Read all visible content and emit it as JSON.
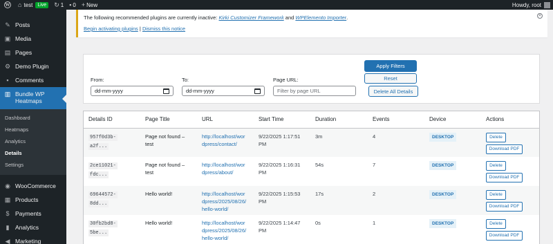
{
  "adminbar": {
    "site_name": "test",
    "live_badge": "Live",
    "updates_count": "1",
    "comments_count": "0",
    "new_label": "New",
    "howdy": "Howdy, root"
  },
  "sidebar": {
    "items": [
      {
        "label": "Posts",
        "icon": "pushpin-icon"
      },
      {
        "label": "Media",
        "icon": "media-icon"
      },
      {
        "label": "Pages",
        "icon": "pages-icon"
      },
      {
        "label": "Demo Plugin",
        "icon": "gear-icon"
      },
      {
        "label": "Comments",
        "icon": "comment-icon"
      }
    ],
    "current": {
      "label_line1": "Bundle WP",
      "label_line2": "Heatmaps",
      "icon": "chart-icon"
    },
    "submenu": [
      "Dashboard",
      "Heatmaps",
      "Analytics",
      "Details",
      "Settings"
    ],
    "active_submenu": "Details",
    "items_after": [
      {
        "label": "WooCommerce",
        "icon": "woo-icon"
      },
      {
        "label": "Products",
        "icon": "products-icon"
      },
      {
        "label": "Payments",
        "icon": "payments-icon"
      },
      {
        "label": "Analytics",
        "icon": "analytics-icon"
      },
      {
        "label": "Marketing",
        "icon": "megaphone-icon"
      }
    ]
  },
  "notice": {
    "text_before": "The following recommended plugins are currently inactive: ",
    "plugin1": "Kirki Customizer Framework",
    "and_text": " and ",
    "plugin2": "WPElemento Importer",
    "period": ".",
    "begin_link": "Begin activating plugins",
    "divider": " | ",
    "dismiss_link": "Dismiss this notice"
  },
  "filters": {
    "from_label": "From:",
    "from_value": "dd-mm-yyyy",
    "to_label": "To:",
    "to_value": "dd-mm-yyyy",
    "url_label": "Page URL:",
    "url_placeholder": "Filter by page URL",
    "apply_label": "Apply Filters",
    "reset_label": "Reset",
    "delete_all_label": "Delete All Details"
  },
  "table": {
    "headers": [
      "Details ID",
      "Page Title",
      "URL",
      "Start Time",
      "Duration",
      "Events",
      "Device",
      "Actions"
    ],
    "delete_label": "Delete",
    "pdf_label": "Download PDF",
    "rows": [
      {
        "id_line1": "957f0d3b-",
        "id_line2": "a2f...",
        "title_line1": "Page not found –",
        "title_line2": "test",
        "url_line1": "http://localhost/wor",
        "url_line2": "dpress/contact/",
        "url_line3": "",
        "time_line1": "9/22/2025 1:17:51",
        "time_line2": "PM",
        "duration": "3m",
        "events": "4",
        "device": "DESKTOP"
      },
      {
        "id_line1": "2ce11021-",
        "id_line2": "fdc...",
        "title_line1": "Page not found –",
        "title_line2": "test",
        "url_line1": "http://localhost/wor",
        "url_line2": "dpress/about/",
        "url_line3": "",
        "time_line1": "9/22/2025 1:16:31",
        "time_line2": "PM",
        "duration": "54s",
        "events": "7",
        "device": "DESKTOP"
      },
      {
        "id_line1": "69644572-",
        "id_line2": "8dd...",
        "title_line1": "Hello world!",
        "title_line2": "",
        "url_line1": "http://localhost/wor",
        "url_line2": "dpress/2025/08/26/",
        "url_line3": "hello-world/",
        "time_line1": "9/22/2025 1:15:53",
        "time_line2": "PM",
        "duration": "17s",
        "events": "2",
        "device": "DESKTOP"
      },
      {
        "id_line1": "30fb2bd8-",
        "id_line2": "5be...",
        "title_line1": "Hello world!",
        "title_line2": "",
        "url_line1": "http://localhost/wor",
        "url_line2": "dpress/2025/08/26/",
        "url_line3": "hello-world/",
        "time_line1": "9/22/2025 1:14:47",
        "time_line2": "PM",
        "duration": "0s",
        "events": "1",
        "device": "DESKTOP"
      }
    ]
  }
}
